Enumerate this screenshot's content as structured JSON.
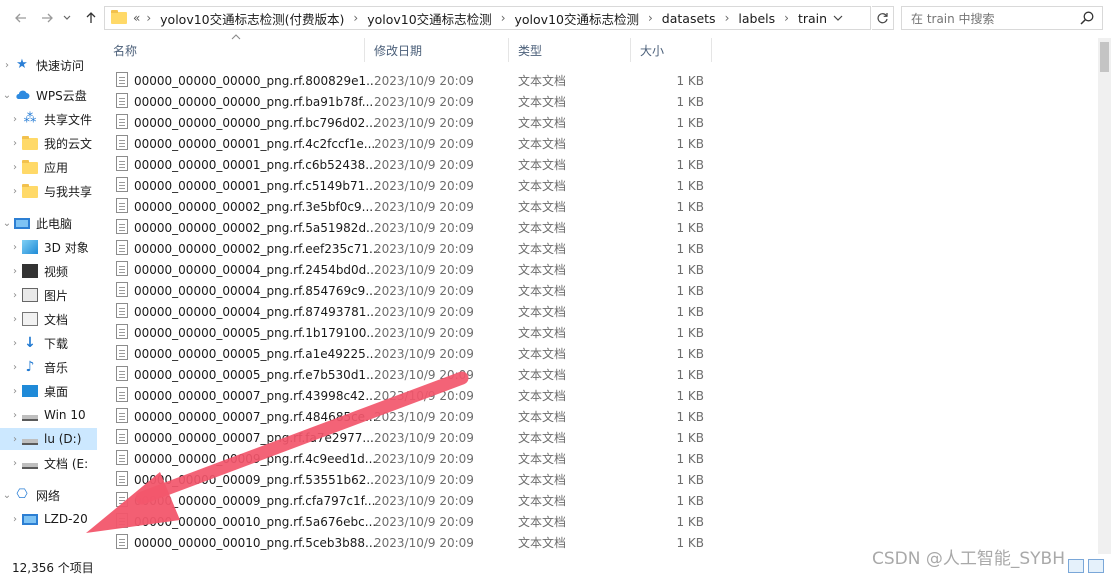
{
  "address": {
    "more": "«",
    "crumbs": [
      "yolov10交通标志检测(付费版本)",
      "yolov10交通标志检测",
      "yolov10交通标志检测",
      "datasets",
      "labels",
      "train"
    ]
  },
  "search": {
    "placeholder": "在 train 中搜索"
  },
  "nav": {
    "items": [
      {
        "label": "快速访问",
        "icon": "star-icon"
      },
      {
        "label": "WPS云盘",
        "icon": "cloud-icon"
      },
      {
        "label": "共享文件",
        "icon": "share-icon"
      },
      {
        "label": "我的云文",
        "icon": "folder-icon"
      },
      {
        "label": "应用",
        "icon": "folder-icon"
      },
      {
        "label": "与我共享",
        "icon": "folder-icon"
      },
      {
        "label": "此电脑",
        "icon": "pc-icon"
      },
      {
        "label": "3D 对象",
        "icon": "cube-icon"
      },
      {
        "label": "视频",
        "icon": "video-icon"
      },
      {
        "label": "图片",
        "icon": "picture-icon"
      },
      {
        "label": "文档",
        "icon": "document-icon"
      },
      {
        "label": "下载",
        "icon": "download-icon"
      },
      {
        "label": "音乐",
        "icon": "music-icon"
      },
      {
        "label": "桌面",
        "icon": "desktop-icon"
      },
      {
        "label": "Win 10",
        "icon": "drive-icon"
      },
      {
        "label": "lu (D:)",
        "icon": "drive-icon"
      },
      {
        "label": "文档 (E:",
        "icon": "drive-icon"
      },
      {
        "label": "网络",
        "icon": "network-icon"
      },
      {
        "label": "LZD-20",
        "icon": "pc-icon"
      }
    ]
  },
  "status": {
    "count": "12,356 个项目"
  },
  "columns": {
    "name": "名称",
    "date": "修改日期",
    "type": "类型",
    "size": "大小"
  },
  "files": [
    {
      "name": "00000_00000_00000_png.rf.800829e1...",
      "date": "2023/10/9 20:09",
      "type": "文本文档",
      "size": "1 KB"
    },
    {
      "name": "00000_00000_00000_png.rf.ba91b78f...",
      "date": "2023/10/9 20:09",
      "type": "文本文档",
      "size": "1 KB"
    },
    {
      "name": "00000_00000_00000_png.rf.bc796d02...",
      "date": "2023/10/9 20:09",
      "type": "文本文档",
      "size": "1 KB"
    },
    {
      "name": "00000_00000_00001_png.rf.4c2fccf1e...",
      "date": "2023/10/9 20:09",
      "type": "文本文档",
      "size": "1 KB"
    },
    {
      "name": "00000_00000_00001_png.rf.c6b52438...",
      "date": "2023/10/9 20:09",
      "type": "文本文档",
      "size": "1 KB"
    },
    {
      "name": "00000_00000_00001_png.rf.c5149b71...",
      "date": "2023/10/9 20:09",
      "type": "文本文档",
      "size": "1 KB"
    },
    {
      "name": "00000_00000_00002_png.rf.3e5bf0c9...",
      "date": "2023/10/9 20:09",
      "type": "文本文档",
      "size": "1 KB"
    },
    {
      "name": "00000_00000_00002_png.rf.5a51982d...",
      "date": "2023/10/9 20:09",
      "type": "文本文档",
      "size": "1 KB"
    },
    {
      "name": "00000_00000_00002_png.rf.eef235c71...",
      "date": "2023/10/9 20:09",
      "type": "文本文档",
      "size": "1 KB"
    },
    {
      "name": "00000_00000_00004_png.rf.2454bd0d...",
      "date": "2023/10/9 20:09",
      "type": "文本文档",
      "size": "1 KB"
    },
    {
      "name": "00000_00000_00004_png.rf.854769c9...",
      "date": "2023/10/9 20:09",
      "type": "文本文档",
      "size": "1 KB"
    },
    {
      "name": "00000_00000_00004_png.rf.87493781...",
      "date": "2023/10/9 20:09",
      "type": "文本文档",
      "size": "1 KB"
    },
    {
      "name": "00000_00000_00005_png.rf.1b179100...",
      "date": "2023/10/9 20:09",
      "type": "文本文档",
      "size": "1 KB"
    },
    {
      "name": "00000_00000_00005_png.rf.a1e49225...",
      "date": "2023/10/9 20:09",
      "type": "文本文档",
      "size": "1 KB"
    },
    {
      "name": "00000_00000_00005_png.rf.e7b530d1...",
      "date": "2023/10/9 20:09",
      "type": "文本文档",
      "size": "1 KB"
    },
    {
      "name": "00000_00000_00007_png.rf.43998c42...",
      "date": "2023/10/9 20:09",
      "type": "文本文档",
      "size": "1 KB"
    },
    {
      "name": "00000_00000_00007_png.rf.484685ce...",
      "date": "2023/10/9 20:09",
      "type": "文本文档",
      "size": "1 KB"
    },
    {
      "name": "00000_00000_00007_png.rf.fa7e2977...",
      "date": "2023/10/9 20:09",
      "type": "文本文档",
      "size": "1 KB"
    },
    {
      "name": "00000_00000_00009_png.rf.4c9eed1d...",
      "date": "2023/10/9 20:09",
      "type": "文本文档",
      "size": "1 KB"
    },
    {
      "name": "00000_00000_00009_png.rf.53551b62...",
      "date": "2023/10/9 20:09",
      "type": "文本文档",
      "size": "1 KB"
    },
    {
      "name": "00000_00000_00009_png.rf.cfa797c1f...",
      "date": "2023/10/9 20:09",
      "type": "文本文档",
      "size": "1 KB"
    },
    {
      "name": "00000_00000_00010_png.rf.5a676ebc...",
      "date": "2023/10/9 20:09",
      "type": "文本文档",
      "size": "1 KB"
    },
    {
      "name": "00000_00000_00010_png.rf.5ceb3b88...",
      "date": "2023/10/9 20:09",
      "type": "文本文档",
      "size": "1 KB"
    }
  ],
  "watermark": "CSDN @人工智能_SYBH",
  "colors": {
    "arrow": "#f2566b",
    "selection": "#cce8ff",
    "folder": "#ffd968"
  }
}
